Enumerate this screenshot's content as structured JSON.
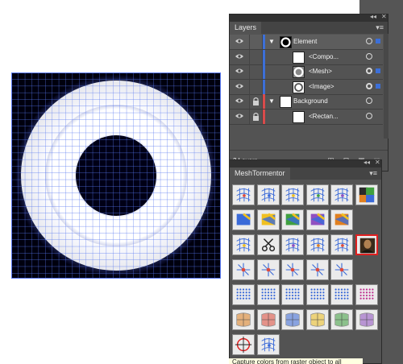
{
  "layers_panel": {
    "collapse_glyph": "◂◂",
    "close_glyph": "✕",
    "tab_label": "Layers",
    "menu_glyph": "▾≡",
    "rows": [
      {
        "label": "Element",
        "color": "#3c6fd8",
        "thumb": "element",
        "level": 0,
        "expanded": true,
        "locked": false,
        "selected": true
      },
      {
        "label": "<Compo...",
        "color": "#3c6fd8",
        "thumb": "white",
        "level": 1,
        "locked": false,
        "selected": false
      },
      {
        "label": "<Mesh>",
        "color": "#3c6fd8",
        "thumb": "mesh",
        "level": 1,
        "locked": false,
        "selected": true
      },
      {
        "label": "<Image>",
        "color": "#3c6fd8",
        "thumb": "image",
        "level": 1,
        "locked": false,
        "selected": true
      },
      {
        "label": "Background",
        "color": "#d94b4b",
        "thumb": "white",
        "level": 0,
        "expanded": true,
        "locked": true,
        "selected": false
      },
      {
        "label": "<Rectan...",
        "color": "#d94b4b",
        "thumb": "white",
        "level": 1,
        "locked": true,
        "selected": false
      }
    ],
    "footer_count": "2 Layers",
    "footer_icons": [
      "search-icon",
      "locate-icon",
      "make-clipping-mask-icon",
      "new-sublayer-icon",
      "new-layer-icon",
      "delete-icon"
    ]
  },
  "mesh_panel": {
    "collapse_glyph": "◂◂",
    "close_glyph": "✕",
    "tab_label": "MeshTormentor",
    "menu_glyph": "▾≡",
    "active_tool": "capture-colors-tool",
    "tooltip_text": "Capture colors from raster object to all"
  }
}
